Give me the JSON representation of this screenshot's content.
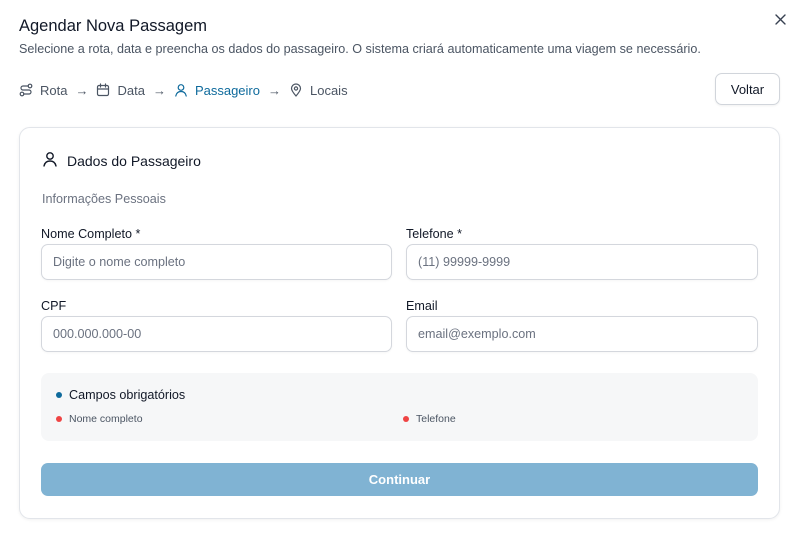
{
  "dialog": {
    "title": "Agendar Nova Passagem",
    "subtitle": "Selecione a rota, data e preencha os dados do passageiro. O sistema criará automaticamente uma viagem se necessário.",
    "back_label": "Voltar"
  },
  "steps": [
    {
      "label": "Rota",
      "icon": "route-icon"
    },
    {
      "label": "Data",
      "icon": "calendar-icon"
    },
    {
      "label": "Passageiro",
      "icon": "user-icon",
      "active": true
    },
    {
      "label": "Locais",
      "icon": "map-pin-icon"
    }
  ],
  "arrow": "→",
  "card": {
    "title": "Dados do Passageiro",
    "section": "Informações Pessoais",
    "fields": {
      "name": {
        "label": "Nome Completo *",
        "placeholder": "Digite o nome completo",
        "value": ""
      },
      "phone": {
        "label": "Telefone *",
        "placeholder": "(11) 99999-9999",
        "value": ""
      },
      "cpf": {
        "label": "CPF",
        "placeholder": "000.000.000-00",
        "value": ""
      },
      "email": {
        "label": "Email",
        "placeholder": "email@exemplo.com",
        "value": ""
      }
    },
    "required": {
      "title": "Campos obrigatórios",
      "items": [
        "Nome completo",
        "Telefone"
      ]
    },
    "continue_label": "Continuar"
  },
  "colors": {
    "accent": "#0e6a9c",
    "required_dot": "#ef4444",
    "continue_disabled": "#80b3d3"
  }
}
